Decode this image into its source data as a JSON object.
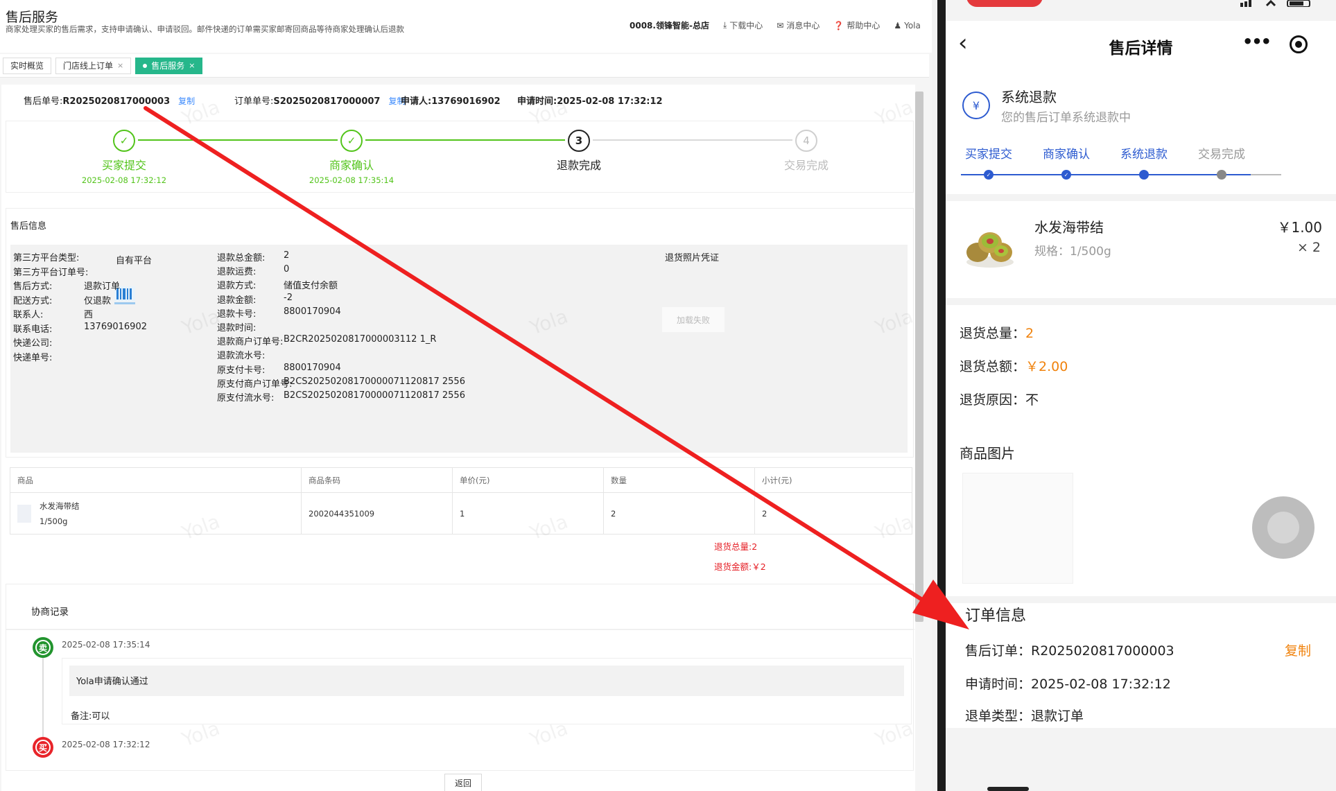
{
  "admin": {
    "header": {
      "title": "售后服务",
      "desc": "商家处理买家的售后需求，支持申请确认、申请驳回。邮件快递的订单需买家邮寄回商品等待商家处理确认后退款",
      "store": "0008.领锋智能-总店",
      "download": "下载中心",
      "message": "消息中心",
      "help": "帮助中心",
      "user": "Yola"
    },
    "tabs": [
      {
        "label": "实时概览"
      },
      {
        "label": "门店线上订单",
        "close": "×"
      },
      {
        "label": "售后服务",
        "close": "×"
      }
    ],
    "ids": {
      "aftersale_label": "售后单号:",
      "aftersale_no": "R2025020817000003",
      "order_label": "订单单号:",
      "order_no": "S2025020817000007",
      "copy": "复制",
      "applicant": "申请人:13769016902",
      "apply_time": "申请时间:2025-02-08 17:32:12"
    },
    "steps": [
      {
        "num": "✓",
        "label": "买家提交",
        "date": "2025-02-08 17:32:12"
      },
      {
        "num": "✓",
        "label": "商家确认",
        "date": "2025-02-08 17:35:14"
      },
      {
        "num": "3",
        "label": "退款完成",
        "date": ""
      },
      {
        "num": "4",
        "label": "交易完成",
        "date": ""
      }
    ],
    "info": {
      "title": "售后信息",
      "left": [
        {
          "k": "第三方平台类型:",
          "v": "自有平台"
        },
        {
          "k": "第三方平台订单号:",
          "v": ""
        },
        {
          "k": "售后方式:",
          "v": "退款订单"
        },
        {
          "k": "配送方式:",
          "v": "仅退款"
        },
        {
          "k": "联系人:",
          "v": "西"
        },
        {
          "k": "联系电话:",
          "v": "13769016902"
        },
        {
          "k": "快递公司:",
          "v": ""
        },
        {
          "k": "快递单号:",
          "v": ""
        }
      ],
      "mid": [
        {
          "k": "退款总金额:",
          "v": "2"
        },
        {
          "k": "退款运费:",
          "v": "0"
        },
        {
          "k": "退款方式:",
          "v": "储值支付余额"
        },
        {
          "k": "退款金额:",
          "v": "-2"
        },
        {
          "k": "退款卡号:",
          "v": "8800170904"
        },
        {
          "k": "退款时间:",
          "v": ""
        },
        {
          "k": "退款商户订单号:",
          "v": "B2CR2025020817000003112 1_R"
        },
        {
          "k": "退款流水号:",
          "v": ""
        },
        {
          "k": "原支付卡号:",
          "v": "8800170904"
        },
        {
          "k": "原支付商户订单号:",
          "v": "B2CS20250208170000071120817 2556"
        },
        {
          "k": "原支付流水号:",
          "v": "B2CS20250208170000071120817 2556"
        }
      ],
      "photo_label": "退货照片凭证",
      "photo_fail": "加载失败"
    },
    "table": {
      "headers": [
        "商品",
        "商品条码",
        "单价(元)",
        "数量",
        "小计(元)"
      ],
      "rows": [
        {
          "name": "水发海带结",
          "spec": "1/500g",
          "barcode": "2002044351009",
          "price": "1",
          "qty": "2",
          "subtotal": "2"
        }
      ]
    },
    "summary": {
      "total_qty": "退货总量:2",
      "total_amount": "退货金额:￥2"
    },
    "negotiation": {
      "title": "协商记录",
      "entries": [
        {
          "badge": "卖",
          "time": "2025-02-08 17:35:14",
          "msg": "Yola申请确认通过",
          "note": "备注:可以"
        },
        {
          "badge": "买",
          "time": "2025-02-08 17:32:12"
        }
      ]
    },
    "back": "返回",
    "watermark": "Yola"
  },
  "phone": {
    "title": "售后详情",
    "status_title": "系统退款",
    "status_desc": "您的售后订单系统退款中",
    "progress": [
      "买家提交",
      "商家确认",
      "系统退款",
      "交易完成"
    ],
    "product": {
      "name": "水发海带结",
      "spec": "规格：1/500g",
      "price": "￥1.00",
      "qty": "× 2"
    },
    "return": {
      "qty_label": "退货总量：",
      "qty": "2",
      "amount_label": "退货总额：",
      "amount": "￥2.00",
      "reason_label": "退货原因：",
      "reason": "不"
    },
    "image_title": "商品图片",
    "order": {
      "title": "订单信息",
      "aftersale_label": "售后订单：",
      "aftersale_no": "R2025020817000003",
      "copy": "复制",
      "time_label": "申请时间：",
      "time": "2025-02-08 17:32:12",
      "type_label": "退单类型：",
      "type": "退款订单"
    }
  },
  "colors": {
    "admin_green": "#52c41a",
    "tab_active": "#26b78b",
    "phone_blue": "#2d5bd0",
    "phone_orange": "#f0820c",
    "alert_red": "#e51c23",
    "arrow_red": "#ee2020"
  }
}
